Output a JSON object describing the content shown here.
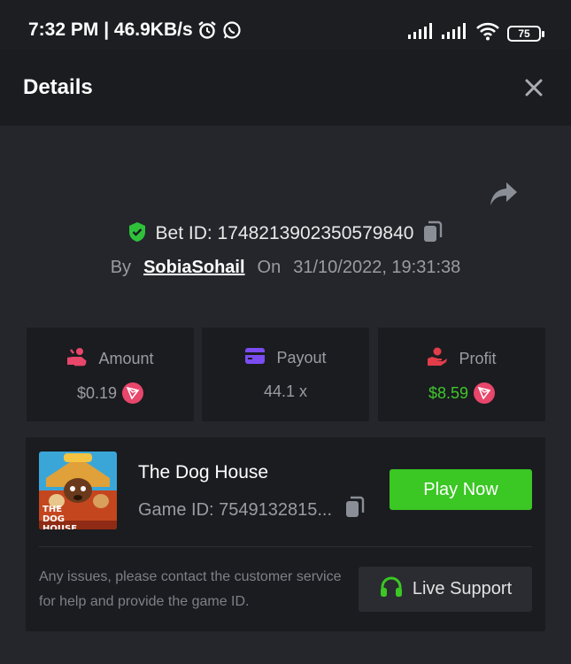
{
  "status_bar": {
    "time_speed": "7:32 PM | 46.9KB/s",
    "battery": "75"
  },
  "header": {
    "title": "Details"
  },
  "bet": {
    "label": "Bet ID: 1748213902350579840",
    "by_label": "By",
    "username": "SobiaSohail",
    "on_label": "On",
    "datetime": "31/10/2022, 19:31:38"
  },
  "stats": {
    "amount": {
      "label": "Amount",
      "value": "$0.19"
    },
    "payout": {
      "label": "Payout",
      "value": "44.1 x"
    },
    "profit": {
      "label": "Profit",
      "value": "$8.59"
    }
  },
  "game": {
    "name": "The Dog House",
    "id_label": "Game ID: 7549132815...",
    "thumb_text": "THE DOG HOUSE",
    "play_label": "Play Now",
    "notice": "Any issues, please contact the customer service for help and provide the game ID.",
    "support_label": "Live Support"
  },
  "colors": {
    "accent_green": "#3bc724",
    "shield_green": "#2fc13a",
    "coin_pink": "#e8466b",
    "payout_purple": "#7b4cf0",
    "profit_red": "#e23d4a"
  }
}
